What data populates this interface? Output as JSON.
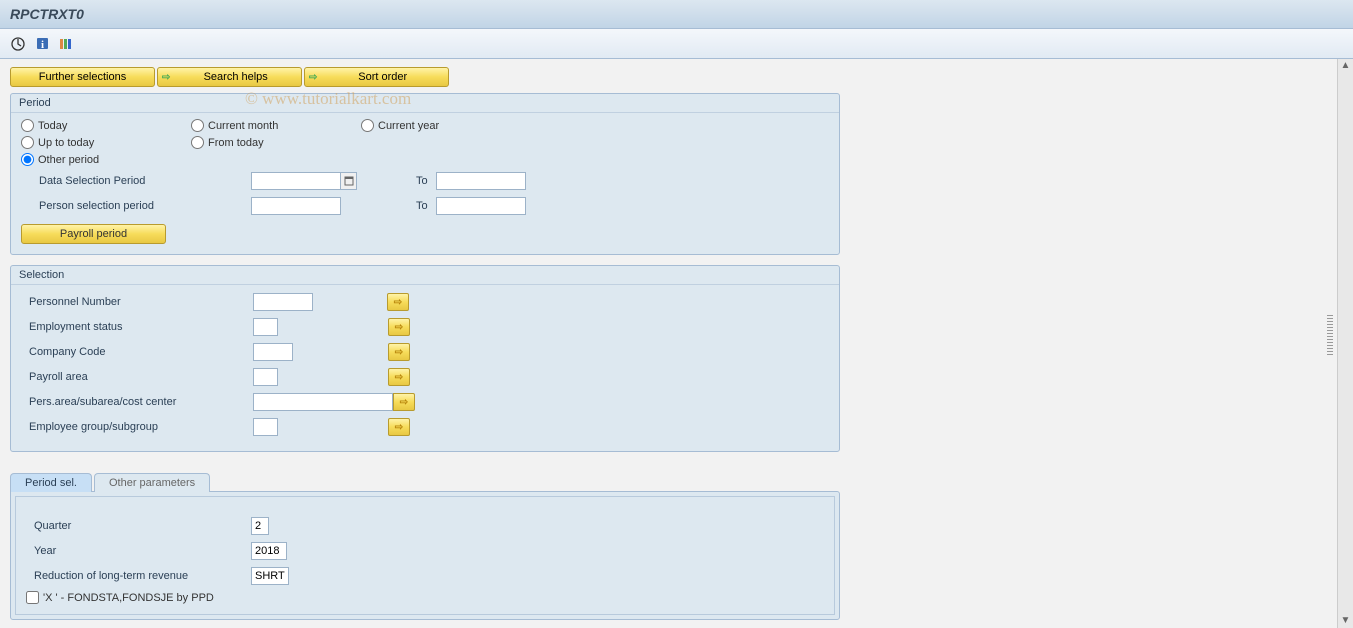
{
  "title": "RPCTRXT0",
  "watermark": "© www.tutorialkart.com",
  "topButtons": {
    "further": "Further selections",
    "search": "Search helps",
    "sort": "Sort order"
  },
  "periodGroup": {
    "title": "Period",
    "radios": {
      "today": "Today",
      "currentMonth": "Current month",
      "currentYear": "Current year",
      "upToToday": "Up to today",
      "fromToday": "From today",
      "otherPeriod": "Other period"
    },
    "dataSelectionPeriod": "Data Selection Period",
    "personSelectionPeriod": "Person selection period",
    "to": "To",
    "payrollPeriod": "Payroll period"
  },
  "selectionGroup": {
    "title": "Selection",
    "personnelNumber": "Personnel Number",
    "employmentStatus": "Employment status",
    "companyCode": "Company Code",
    "payrollArea": "Payroll area",
    "persArea": "Pers.area/subarea/cost center",
    "employeeGroup": "Employee group/subgroup"
  },
  "tabs": {
    "periodSel": "Period sel.",
    "otherParams": "Other parameters"
  },
  "periodSelTab": {
    "quarter": "Quarter",
    "quarterVal": "2",
    "year": "Year",
    "yearVal": "2018",
    "reduction": "Reduction of long-term revenue",
    "reductionVal": "SHRT",
    "fondsta": "'X ' - FONDSTA,FONDSJE by PPD"
  }
}
